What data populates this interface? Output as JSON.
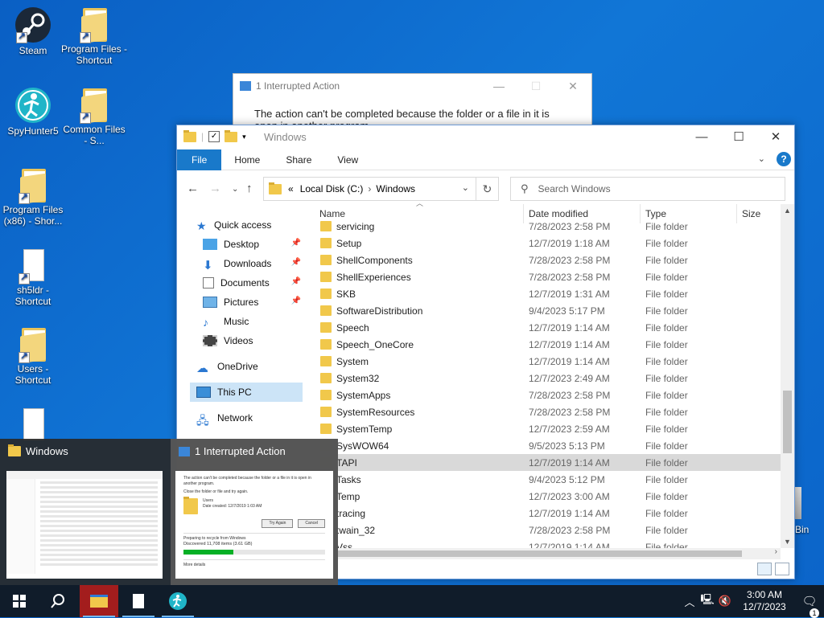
{
  "desktop": {
    "icons": [
      {
        "label": "Steam"
      },
      {
        "label": "Program Files - Shortcut"
      },
      {
        "label": "SpyHunter5"
      },
      {
        "label": "Common Files - S..."
      },
      {
        "label": "Program Files (x86) - Shor..."
      },
      {
        "label": "sh5ldr - Shortcut"
      },
      {
        "label": "Users - Shortcut"
      },
      {
        "label": "Bin"
      }
    ]
  },
  "bg_dialog": {
    "title": "1 Interrupted Action",
    "message": "The action can't be completed because the folder or a file in it is open in another program."
  },
  "explorer": {
    "title": "Windows",
    "tabs": [
      "File",
      "Home",
      "Share",
      "View"
    ],
    "address": {
      "prefix": "«",
      "crumbs": [
        "Local Disk (C:)",
        "Windows"
      ]
    },
    "search_placeholder": "Search Windows",
    "nav": {
      "quick_access": "Quick access",
      "items": [
        "Desktop",
        "Downloads",
        "Documents",
        "Pictures",
        "Music",
        "Videos"
      ],
      "onedrive": "OneDrive",
      "this_pc": "This PC",
      "network": "Network"
    },
    "columns": {
      "name": "Name",
      "date": "Date modified",
      "type": "Type",
      "size": "Size"
    },
    "rows": [
      {
        "name": "servicing",
        "date": "7/28/2023 2:58 PM",
        "type": "File folder"
      },
      {
        "name": "Setup",
        "date": "12/7/2019 1:18 AM",
        "type": "File folder"
      },
      {
        "name": "ShellComponents",
        "date": "7/28/2023 2:58 PM",
        "type": "File folder"
      },
      {
        "name": "ShellExperiences",
        "date": "7/28/2023 2:58 PM",
        "type": "File folder"
      },
      {
        "name": "SKB",
        "date": "12/7/2019 1:31 AM",
        "type": "File folder"
      },
      {
        "name": "SoftwareDistribution",
        "date": "9/4/2023 5:17 PM",
        "type": "File folder"
      },
      {
        "name": "Speech",
        "date": "12/7/2019 1:14 AM",
        "type": "File folder"
      },
      {
        "name": "Speech_OneCore",
        "date": "12/7/2019 1:14 AM",
        "type": "File folder"
      },
      {
        "name": "System",
        "date": "12/7/2019 1:14 AM",
        "type": "File folder"
      },
      {
        "name": "System32",
        "date": "12/7/2023 2:49 AM",
        "type": "File folder"
      },
      {
        "name": "SystemApps",
        "date": "7/28/2023 2:58 PM",
        "type": "File folder"
      },
      {
        "name": "SystemResources",
        "date": "7/28/2023 2:58 PM",
        "type": "File folder"
      },
      {
        "name": "SystemTemp",
        "date": "12/7/2023 2:59 AM",
        "type": "File folder"
      },
      {
        "name": "SysWOW64",
        "date": "9/5/2023 5:13 PM",
        "type": "File folder"
      },
      {
        "name": "TAPI",
        "date": "12/7/2019 1:14 AM",
        "type": "File folder"
      },
      {
        "name": "Tasks",
        "date": "9/4/2023 5:12 PM",
        "type": "File folder"
      },
      {
        "name": "Temp",
        "date": "12/7/2023 3:00 AM",
        "type": "File folder"
      },
      {
        "name": "tracing",
        "date": "12/7/2019 1:14 AM",
        "type": "File folder"
      },
      {
        "name": "twain_32",
        "date": "7/28/2023 2:58 PM",
        "type": "File folder"
      },
      {
        "name": "Vss",
        "date": "12/7/2019 1:14 AM",
        "type": "File folder"
      }
    ]
  },
  "thumbnails": {
    "explorer_title": "Windows",
    "dialog_title": "1 Interrupted Action",
    "dialog_preview": {
      "message": "The action can't be completed because the folder or a file in it is open in another program.",
      "instruction": "Close the folder or file and try again.",
      "item_name": "Users",
      "item_date": "Date created: 12/7/2019 1:03 AM",
      "try_again": "Try Again",
      "cancel": "Cancel",
      "preparing": "Preparing to recycle from Windows",
      "discovered": "Discovered 11,708 items (3.61 GB)",
      "progress": 0.35,
      "more_details": "More details"
    }
  },
  "taskbar": {
    "time": "3:00 AM",
    "date": "12/7/2023",
    "notifications": "1"
  }
}
